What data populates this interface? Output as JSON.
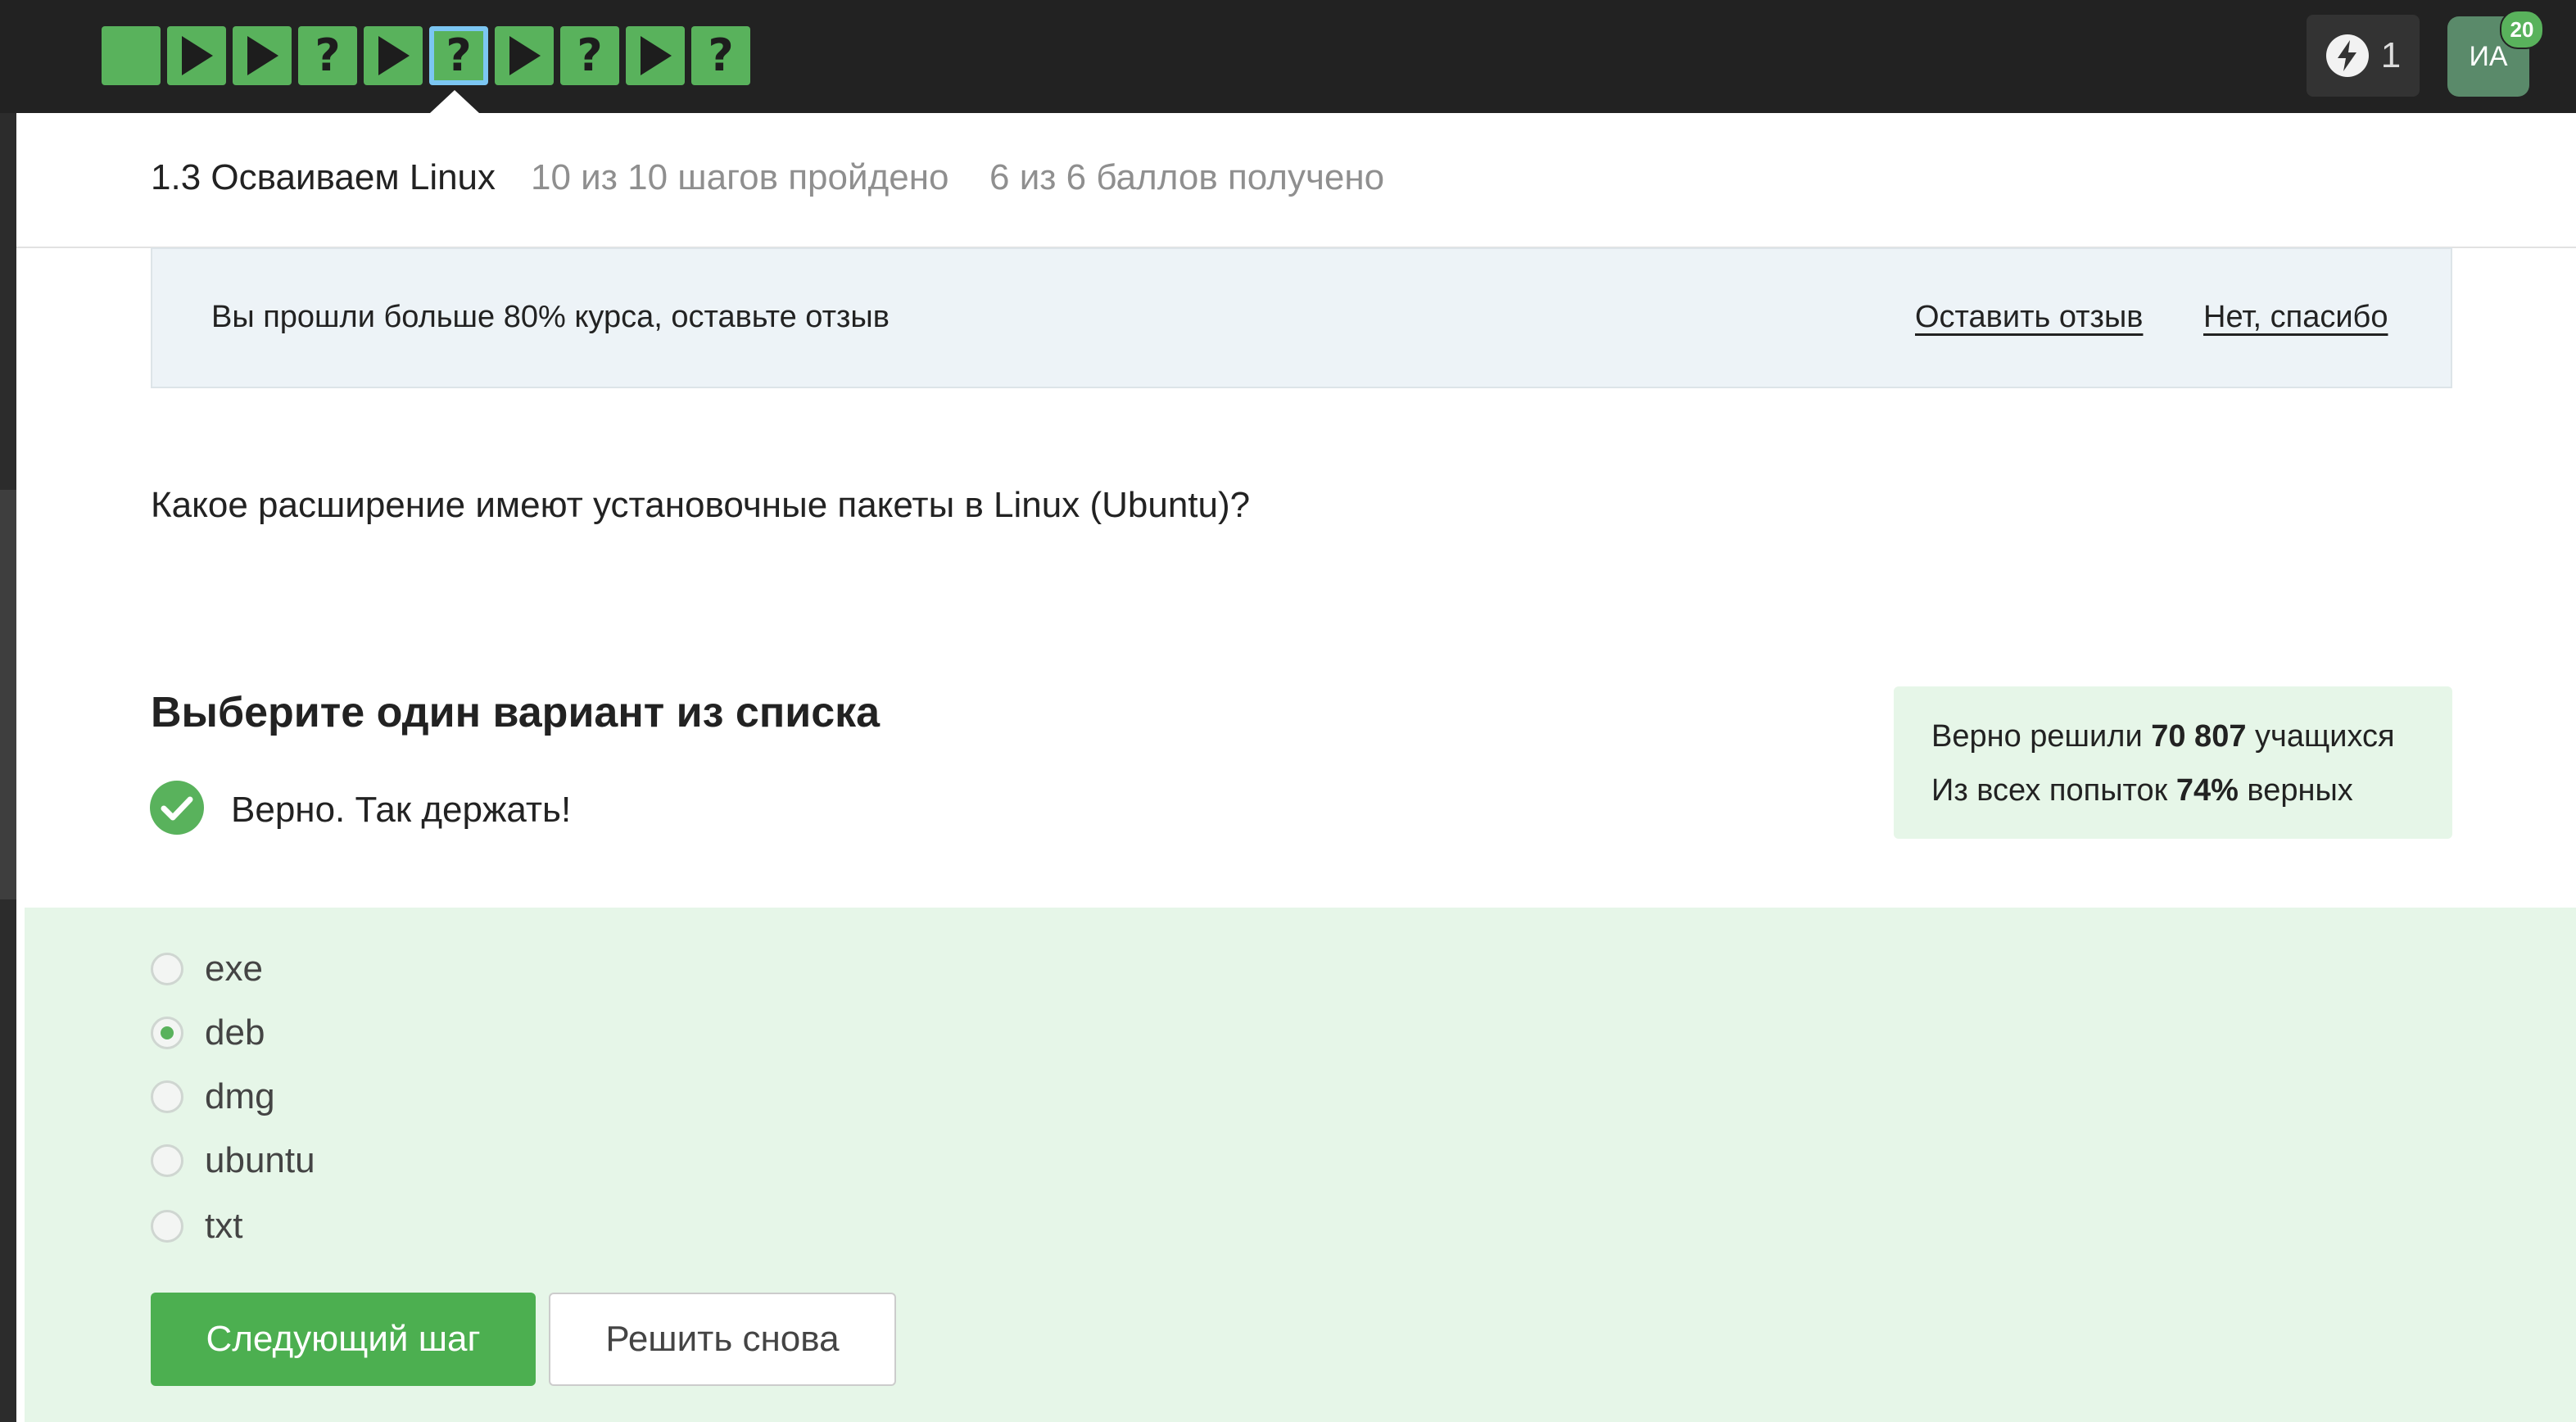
{
  "topbar": {
    "steps": [
      {
        "type": "text",
        "current": false
      },
      {
        "type": "video",
        "current": false
      },
      {
        "type": "video",
        "current": false
      },
      {
        "type": "quiz",
        "label": "?",
        "current": false
      },
      {
        "type": "video",
        "current": false
      },
      {
        "type": "quiz",
        "label": "?",
        "current": true
      },
      {
        "type": "video",
        "current": false
      },
      {
        "type": "quiz",
        "label": "?",
        "current": false
      },
      {
        "type": "video",
        "current": false
      },
      {
        "type": "quiz",
        "label": "?",
        "current": false
      }
    ],
    "energy_count": "1",
    "avatar_initials": "ИА",
    "notification_count": "20"
  },
  "lesson": {
    "title": "1.3 Осваиваем Linux",
    "steps_progress": "10 из 10 шагов пройдено",
    "points": "6 из 6 баллов  получено"
  },
  "banner": {
    "text": "Вы прошли больше 80% курса, оставьте отзыв",
    "leave_review": "Оставить отзыв",
    "no_thanks": "Нет, спасибо"
  },
  "question": {
    "text": "Какое расширение имеют установочные пакеты в Linux (Ubuntu)?",
    "instruction": "Выберите один вариант из списка",
    "result": "Верно. Так держать!"
  },
  "stats": {
    "line1_prefix": "Верно решили ",
    "line1_value": "70 807",
    "line1_suffix": " учащихся",
    "line2_prefix": "Из всех попыток ",
    "line2_value": "74%",
    "line2_suffix": " верных"
  },
  "options": [
    {
      "label": "exe",
      "checked": false
    },
    {
      "label": "deb",
      "checked": true
    },
    {
      "label": "dmg",
      "checked": false
    },
    {
      "label": "ubuntu",
      "checked": false
    },
    {
      "label": "txt",
      "checked": false
    }
  ],
  "buttons": {
    "next": "Следующий шаг",
    "retry": "Решить снова"
  },
  "colors": {
    "accent": "#59b25c",
    "topbar": "#222222",
    "success_bg": "#e6f6e8",
    "banner_bg": "#edf3f7"
  }
}
